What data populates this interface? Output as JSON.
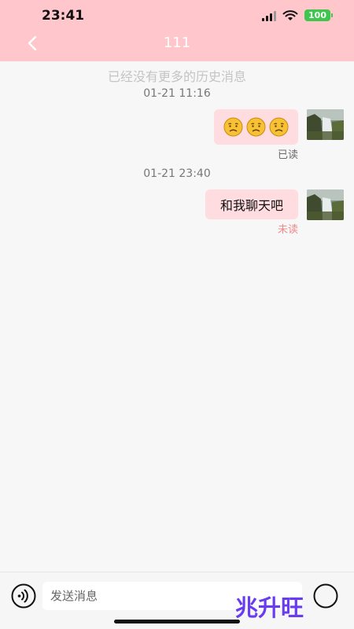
{
  "status_bar": {
    "time": "23:41",
    "battery": "100"
  },
  "header": {
    "title": "111"
  },
  "chat": {
    "no_more_history": "已经没有更多的历史消息",
    "messages": [
      {
        "timestamp": "01-21 11:16",
        "content_type": "emoji",
        "emoji": [
          "confused-face",
          "confused-face",
          "confused-face"
        ],
        "read_status": "已读",
        "read_color": "#6a6a6a"
      },
      {
        "timestamp": "01-21 23:40",
        "content_type": "text",
        "text": "和我聊天吧",
        "read_status": "未读",
        "read_color": "#f08a8a"
      }
    ]
  },
  "input": {
    "placeholder": "发送消息"
  },
  "watermark": "兆升旺",
  "colors": {
    "header_bg": "#ffc6cc",
    "bubble_bg": "#ffdcdf",
    "page_bg": "#f7f7f7"
  }
}
